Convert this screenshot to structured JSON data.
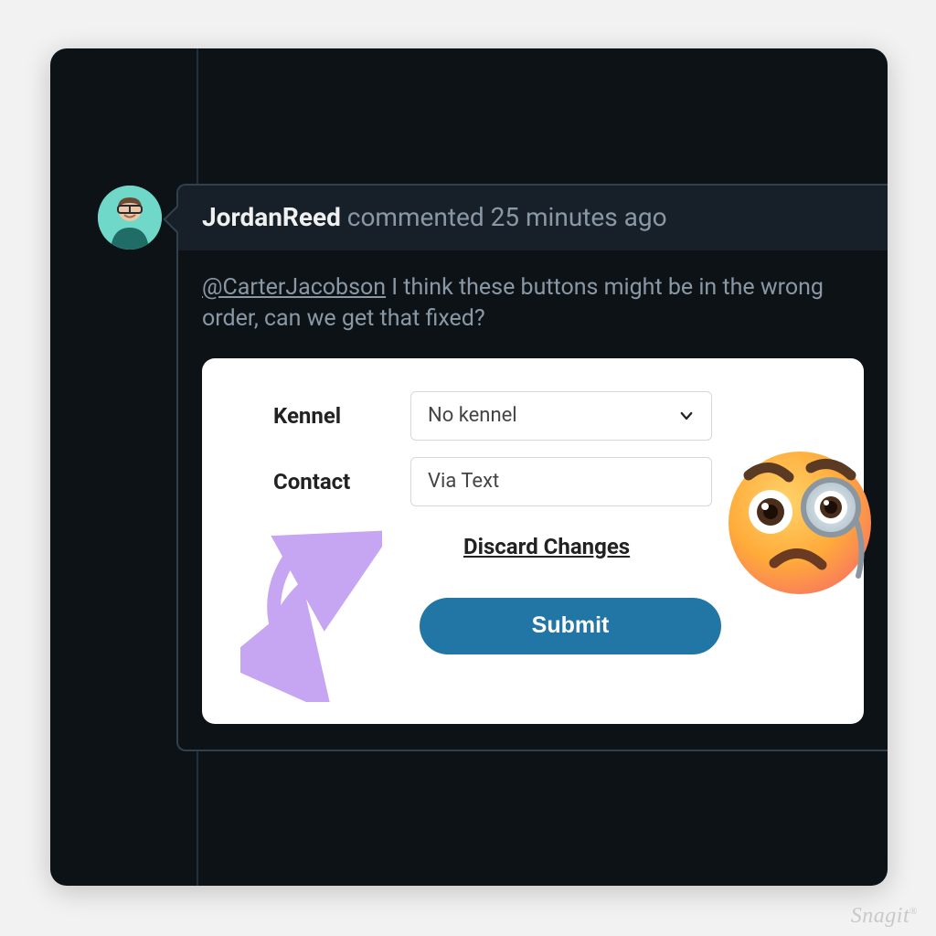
{
  "comment": {
    "username": "JordanReed",
    "action_text": "commented 25 minutes ago",
    "mention": "@CarterJacobson",
    "message_rest": " I think these buttons might be in the wrong order, can we get that fixed?"
  },
  "form": {
    "kennel_label": "Kennel",
    "kennel_value": "No kennel",
    "contact_label": "Contact",
    "contact_value": "Via Text",
    "discard_label": "Discard Changes",
    "submit_label": "Submit"
  },
  "annotations": {
    "emoji_name": "face-with-monocle",
    "swap_arrow_name": "swap-arrow-annotation",
    "swap_arrow_color": "#c6a5f2"
  },
  "watermark": "Snagit"
}
